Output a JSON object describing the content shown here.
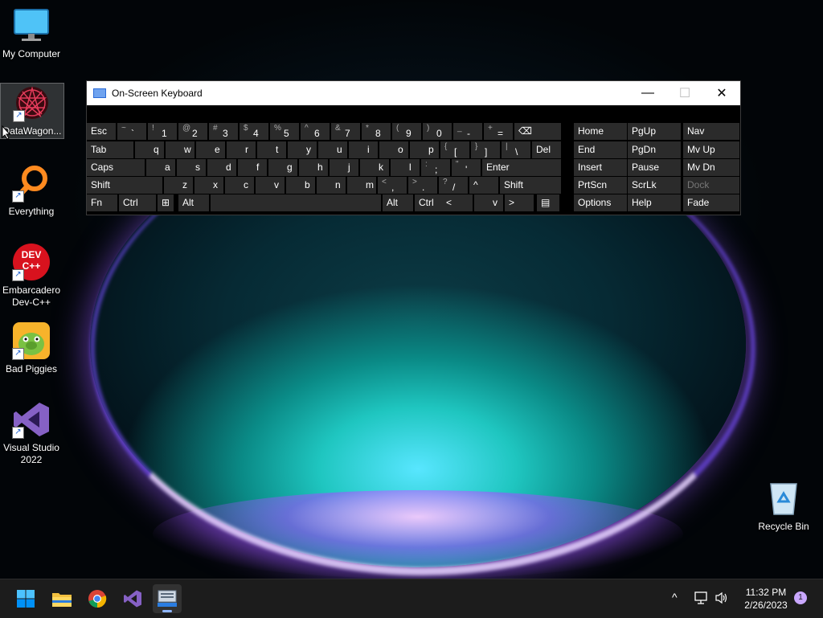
{
  "desktop": {
    "icons": [
      {
        "label": "My Computer"
      },
      {
        "label": "DataWagon..."
      },
      {
        "label": "Everything"
      },
      {
        "label": "Embarcadero Dev-C++"
      },
      {
        "label": "Bad Piggies"
      },
      {
        "label": "Visual Studio 2022"
      },
      {
        "label": "Recycle Bin"
      }
    ],
    "devcpp_badge": "DEV C++"
  },
  "osk": {
    "title": "On-Screen Keyboard",
    "minimize": "—",
    "maximize": "☐",
    "close": "✕",
    "rows": {
      "row1": [
        "Esc",
        "~ `",
        "! 1",
        "@ 2",
        "# 3",
        "$ 4",
        "% 5",
        "^ 6",
        "& 7",
        "* 8",
        "( 9",
        ") 0",
        "_ -",
        "+ =",
        "⌫"
      ],
      "row2": [
        "Tab",
        "q",
        "w",
        "e",
        "r",
        "t",
        "y",
        "u",
        "i",
        "o",
        "p",
        "{ [",
        "} ]",
        "| \\",
        "Del"
      ],
      "row3": [
        "Caps",
        "a",
        "s",
        "d",
        "f",
        "g",
        "h",
        "j",
        "k",
        "l",
        ": ;",
        "\" '",
        "Enter"
      ],
      "row4": [
        "Shift",
        "z",
        "x",
        "c",
        "v",
        "b",
        "n",
        "m",
        "< ,",
        "> .",
        "? /",
        "^",
        "Shift"
      ],
      "row5": [
        "Fn",
        "Ctrl",
        "⊞",
        "Alt",
        "",
        "Alt",
        "Ctrl",
        "<",
        "v",
        ">",
        "▤"
      ]
    },
    "nav": [
      [
        "Home",
        "PgUp",
        "Nav"
      ],
      [
        "End",
        "PgDn",
        "Mv Up"
      ],
      [
        "Insert",
        "Pause",
        "Mv Dn"
      ],
      [
        "PrtScn",
        "ScrLk",
        "Dock"
      ],
      [
        "Options",
        "Help",
        "Fade"
      ]
    ]
  },
  "taskbar": {
    "apps": [
      "start-icon",
      "file-explorer-icon",
      "chrome-icon",
      "visual-studio-icon",
      "on-screen-keyboard-icon"
    ],
    "tray": {
      "chevron": "^",
      "time": "11:32 PM",
      "date": "2/26/2023",
      "notification_count": "1"
    }
  },
  "colors": {
    "accent": "#0078d4",
    "key_bg": "#2b2b2b",
    "taskbar_bg": "#1c1c1c"
  }
}
